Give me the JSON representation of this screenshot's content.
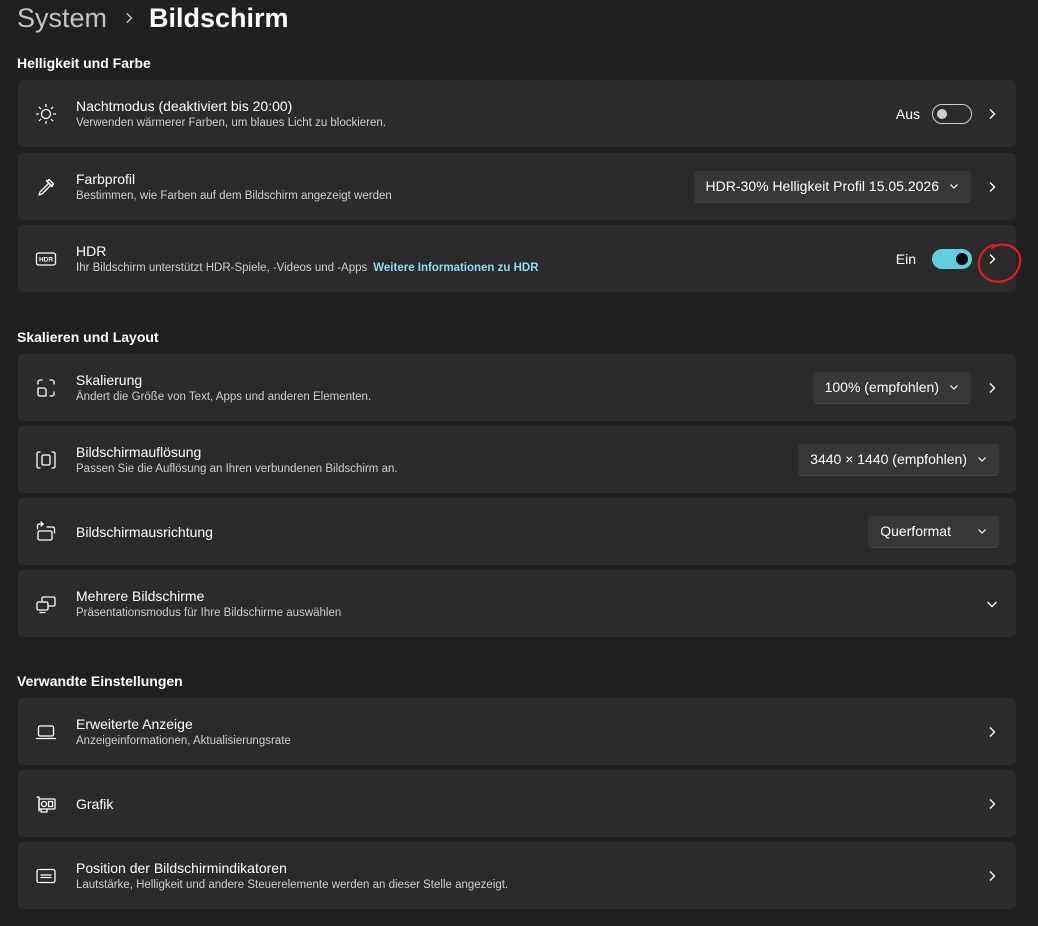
{
  "breadcrumb": {
    "parent": "System",
    "current": "Bildschirm"
  },
  "sections": {
    "brightness": "Helligkeit und Farbe",
    "scaling": "Skalieren und Layout",
    "related": "Verwandte Einstellungen"
  },
  "night_mode": {
    "title": "Nachtmodus (deaktiviert bis 20:00)",
    "desc": "Verwenden wärmerer Farben, um blaues Licht zu blockieren.",
    "state_label": "Aus",
    "enabled": false
  },
  "color_profile": {
    "title": "Farbprofil",
    "desc": "Bestimmen, wie Farben auf dem Bildschirm angezeigt werden",
    "value": "HDR-30% Helligkeit Profil 15.05.2026"
  },
  "hdr": {
    "title": "HDR",
    "desc": "Ihr Bildschirm unterstützt HDR-Spiele, -Videos und -Apps",
    "link": "Weitere Informationen zu HDR",
    "state_label": "Ein",
    "enabled": true
  },
  "scale": {
    "title": "Skalierung",
    "desc": "Ändert die Größe von Text, Apps und anderen Elementen.",
    "value": "100% (empfohlen)"
  },
  "resolution": {
    "title": "Bildschirmauflösung",
    "desc": "Passen Sie die Auflösung an Ihren verbundenen Bildschirm an.",
    "value": "3440 × 1440 (empfohlen)"
  },
  "orientation": {
    "title": "Bildschirmausrichtung",
    "value": "Querformat"
  },
  "multi_display": {
    "title": "Mehrere Bildschirme",
    "desc": "Präsentationsmodus für Ihre Bildschirme auswählen"
  },
  "advanced_display": {
    "title": "Erweiterte Anzeige",
    "desc": "Anzeigeinformationen, Aktualisierungsrate"
  },
  "graphics": {
    "title": "Grafik"
  },
  "indicators": {
    "title": "Position der Bildschirmindikatoren",
    "desc": "Lautstärke, Helligkeit und andere Steuerelemente werden an dieser Stelle angezeigt."
  },
  "colors": {
    "background": "#202020",
    "card": "#2b2b2b",
    "accent": "#60cde0",
    "link": "#8fdcef",
    "annotation": "#e01b1b"
  },
  "icons": {
    "night_mode": "brightness-moon-icon",
    "color_profile": "eyedropper-icon",
    "hdr": "hdr-icon",
    "scale": "scale-icon",
    "resolution": "resolution-icon",
    "orientation": "orientation-icon",
    "multi_display": "multiple-displays-icon",
    "advanced_display": "laptop-icon",
    "graphics": "graphics-card-icon",
    "indicators": "indicator-icon"
  }
}
